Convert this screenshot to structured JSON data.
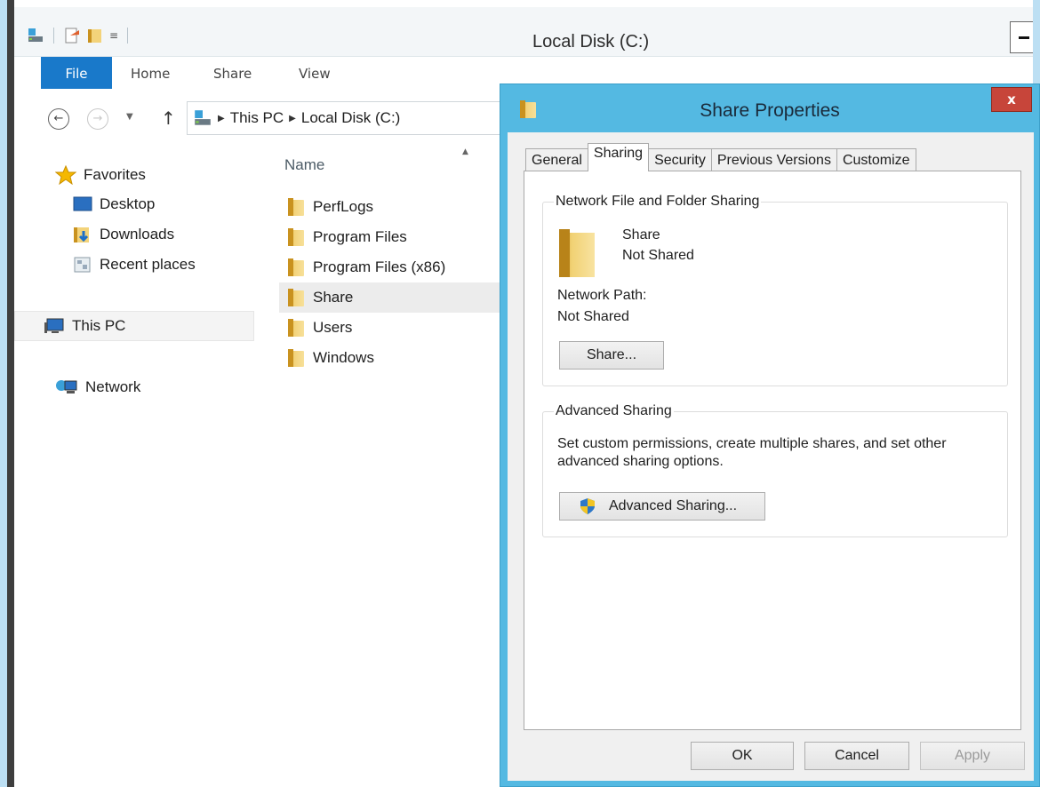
{
  "window": {
    "title": "Local Disk (C:)"
  },
  "ribbon": {
    "tabs": [
      "File",
      "Home",
      "Share",
      "View"
    ]
  },
  "address": {
    "crumbs": [
      "This PC",
      "Local Disk (C:)"
    ]
  },
  "nav_pane": {
    "items": [
      {
        "label": "Favorites",
        "icon": "star-icon"
      },
      {
        "label": "Desktop",
        "icon": "desktop-icon"
      },
      {
        "label": "Downloads",
        "icon": "downloads-icon"
      },
      {
        "label": "Recent places",
        "icon": "recent-places-icon"
      },
      {
        "label": "This PC",
        "icon": "computer-icon"
      },
      {
        "label": "Network",
        "icon": "network-icon"
      }
    ]
  },
  "file_list": {
    "column_name": "Name",
    "items": [
      "PerfLogs",
      "Program Files",
      "Program Files (x86)",
      "Share",
      "Users",
      "Windows"
    ],
    "selected": "Share"
  },
  "dialog": {
    "title": "Share Properties",
    "close_label": "x",
    "tabs": [
      "General",
      "Sharing",
      "Security",
      "Previous Versions",
      "Customize"
    ],
    "active_tab": "Sharing",
    "network_sharing": {
      "legend": "Network File and Folder Sharing",
      "folder_name": "Share",
      "folder_status": "Not Shared",
      "path_label": "Network Path:",
      "path_value": "Not Shared",
      "share_button": "Share..."
    },
    "advanced_sharing": {
      "legend": "Advanced Sharing",
      "description": "Set custom permissions, create multiple shares, and set other advanced sharing options.",
      "button": "Advanced Sharing..."
    },
    "buttons": {
      "ok": "OK",
      "cancel": "Cancel",
      "apply": "Apply"
    }
  },
  "colors": {
    "accent": "#1979ca",
    "dialog_frame": "#54b9e2",
    "close_button": "#c7453a"
  }
}
